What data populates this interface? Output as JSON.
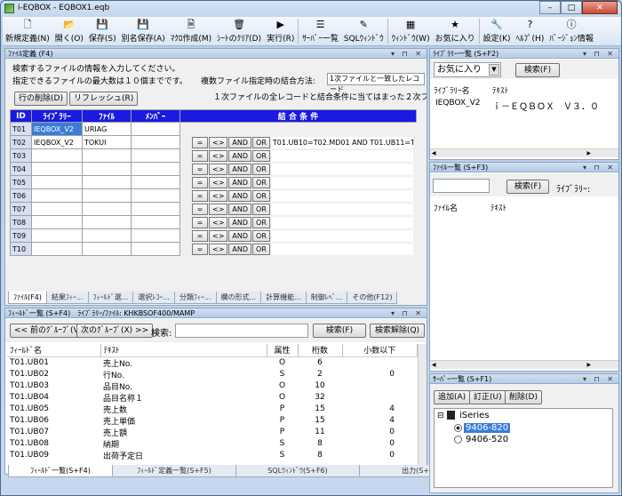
{
  "window": {
    "title": "i-EQBOX - EQBOX1.eqb"
  },
  "toolbar": [
    {
      "icon": "🗋",
      "label": "新規定義(N)",
      "name": "new-def-button"
    },
    {
      "icon": "📂",
      "label": "開く(O)",
      "name": "open-button"
    },
    {
      "icon": "💾",
      "label": "保存(S)",
      "name": "save-button"
    },
    {
      "icon": "💾",
      "label": "別名保存(A)",
      "name": "save-as-button"
    },
    {
      "icon": "🗎",
      "label": "ﾏｸﾛ作成(M)",
      "name": "macro-create-button"
    },
    {
      "icon": "🗑",
      "label": "ｼｰﾄのｸﾘｱ(D)",
      "name": "clear-sheet-button"
    },
    {
      "icon": "▶",
      "label": "実行(R)",
      "name": "run-button"
    },
    {
      "icon": "☰",
      "label": "ｻｰﾊﾞｰ一覧",
      "name": "server-list-button"
    },
    {
      "icon": "✎",
      "label": "SQLｳｨﾝﾄﾞｳ",
      "name": "sql-window-button"
    },
    {
      "icon": "▦",
      "label": "ｳｨﾝﾄﾞｳ(W)",
      "name": "window-button"
    },
    {
      "icon": "★",
      "label": "お気に入り",
      "name": "favorites-button"
    },
    {
      "icon": "🔧",
      "label": "設定(K)",
      "name": "settings-button"
    },
    {
      "icon": "?",
      "label": "ﾍﾙﾌﾟ(H)",
      "name": "help-button"
    },
    {
      "icon": "ⓘ",
      "label": "ﾊﾞｰｼﾞｮﾝ情報",
      "name": "version-button"
    }
  ],
  "file_def": {
    "title": "ﾌｧｲﾙ定義 (F4)",
    "info1": "検索するファイルの情報を入力してください。",
    "info2": "指定できるファイルの最大数は１０個までです。",
    "join_label": "複数ファイル指定時の結合方法:",
    "join_value": "1次ファイルと一致したレコード",
    "join_desc": "１次ファイルの全レコードと結合条件に当てはまった２次ファ",
    "delete_row": "行の削除(D)",
    "refresh": "リフレッシュ(R)",
    "headers": [
      "ID",
      "ﾗｲﾌﾞﾗﾘｰ",
      "ﾌｧｲﾙ",
      "ﾒﾝﾊﾞｰ",
      "結 合 条 件"
    ],
    "cond_buttons": [
      "=",
      "<>",
      "AND",
      "OR"
    ],
    "rows": [
      {
        "id": "T01",
        "lib": "IEQBOX_V2",
        "file": "URIAG",
        "member": "",
        "cond": "",
        "has_buttons": false
      },
      {
        "id": "T02",
        "lib": "IEQBOX_V2",
        "file": "TOKUI",
        "member": "",
        "cond": "T01.UB10=T02.MD01 AND T01.UB11=T02.",
        "has_buttons": true
      },
      {
        "id": "T03",
        "lib": "",
        "file": "",
        "member": "",
        "cond": "",
        "has_buttons": true
      },
      {
        "id": "T04",
        "lib": "",
        "file": "",
        "member": "",
        "cond": "",
        "has_buttons": true
      },
      {
        "id": "T05",
        "lib": "",
        "file": "",
        "member": "",
        "cond": "",
        "has_buttons": true
      },
      {
        "id": "T06",
        "lib": "",
        "file": "",
        "member": "",
        "cond": "",
        "has_buttons": true
      },
      {
        "id": "T07",
        "lib": "",
        "file": "",
        "member": "",
        "cond": "",
        "has_buttons": true
      },
      {
        "id": "T08",
        "lib": "",
        "file": "",
        "member": "",
        "cond": "",
        "has_buttons": true
      },
      {
        "id": "T09",
        "lib": "",
        "file": "",
        "member": "",
        "cond": "",
        "has_buttons": true
      },
      {
        "id": "T10",
        "lib": "",
        "file": "",
        "member": "",
        "cond": "",
        "has_buttons": true
      }
    ],
    "tabs": [
      "ﾌｧｲﾙ(F4)",
      "結果ﾌｨｰ...",
      "ﾌｨｰﾙﾄﾞ選...",
      "選択ﾚｺｰ...",
      "分類ﾌｨｰ...",
      "欄の形式...",
      "計算機能...",
      "制御ﾚﾍﾞ...",
      "その他(F12)"
    ]
  },
  "field_list": {
    "title": "ﾌｨｰﾙﾄﾞ一覧 (S+F4)　ﾗｲﾌﾞﾗﾘｰ/ﾌｧｲﾙ: KHKBSOF400/MAMP",
    "prev": "<< 前のｸﾞﾙｰﾌﾟ(V)",
    "next": "次のｸﾞﾙｰﾌﾟ(X) >>",
    "search_label": "検索:",
    "search_btn": "検索(F)",
    "clear_btn": "検索解除(Q)",
    "headers": [
      "ﾌｨｰﾙﾄﾞ名",
      "ﾃｷｽﾄ",
      "属性",
      "桁数",
      "小数以下"
    ],
    "rows": [
      [
        "T01.UB01",
        "売上No.",
        "O",
        "6",
        ""
      ],
      [
        "T01.UB02",
        "行No.",
        "S",
        "2",
        "0"
      ],
      [
        "T01.UB03",
        "品目No.",
        "O",
        "10",
        ""
      ],
      [
        "T01.UB04",
        "品目名称１",
        "O",
        "32",
        ""
      ],
      [
        "T01.UB05",
        "売上数",
        "P",
        "15",
        "4"
      ],
      [
        "T01.UB06",
        "売上単価",
        "P",
        "15",
        "4"
      ],
      [
        "T01.UB07",
        "売上額",
        "P",
        "11",
        "0"
      ],
      [
        "T01.UB08",
        "納期",
        "S",
        "8",
        "0"
      ],
      [
        "T01.UB09",
        "出荷予定日",
        "S",
        "8",
        "0"
      ]
    ],
    "tabs": [
      "ﾌｨｰﾙﾄﾞ一覧(S+F4)",
      "ﾌｨｰﾙﾄﾞ定義一覧(S+F5)",
      "SQLｳｨﾝﾄﾞｳ(S+F6)",
      "出力(S+F7)"
    ]
  },
  "library_list": {
    "title": "ﾗｲﾌﾞﾗﾘｰ一覧 (S+F2)",
    "favorites": "お気に入り",
    "search": "検索(F)",
    "headers": [
      "ﾗｲﾌﾞﾗﾘｰ名",
      "ﾃｷｽﾄ"
    ],
    "rows": [
      [
        "IEQBOX_V2",
        "ｉ－ＥＱＢＯＸ　Ｖ３．０"
      ]
    ]
  },
  "file_list": {
    "title": "ﾌｧｲﾙ一覧 (S+F3)",
    "search": "検索(F)",
    "library_label": "ﾗｲﾌﾞﾗﾘｰ:",
    "headers": [
      "ﾌｧｲﾙ名",
      "ﾃｷｽﾄ"
    ]
  },
  "server_list": {
    "title": "ｻｰﾊﾞｰ一覧 (S+F1)",
    "add": "追加(A)",
    "edit": "訂正(U)",
    "delete": "削除(D)",
    "root": "iSeries",
    "servers": [
      {
        "name": "9406-820",
        "selected": true
      },
      {
        "name": "9406-520",
        "selected": false
      }
    ]
  }
}
